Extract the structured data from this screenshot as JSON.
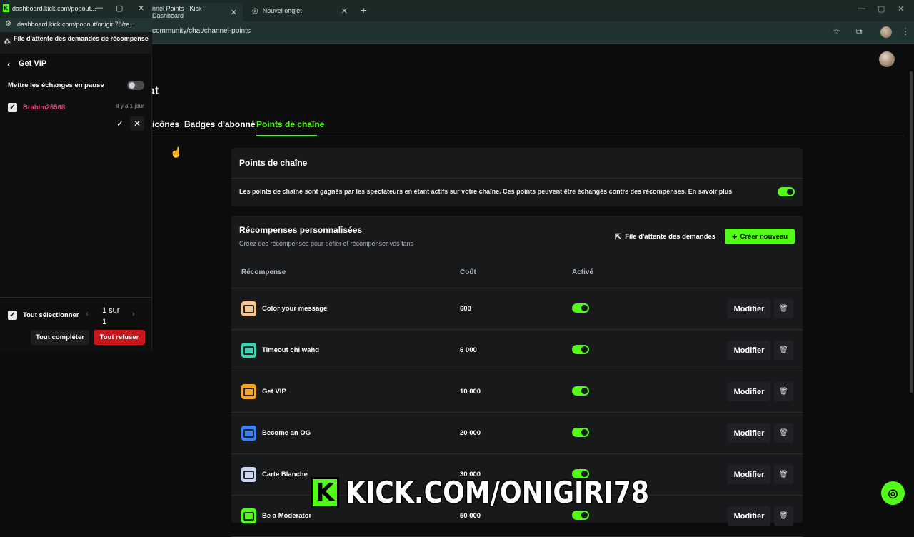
{
  "browser": {
    "tabs": [
      {
        "label": "nnel Points - Kick Dashboard"
      },
      {
        "label": "Nouvel onglet"
      }
    ],
    "url": "community/chat/channel-points"
  },
  "popup": {
    "url_title": "dashboard.kick.com/popout...",
    "url": "dashboard.kick.com/popout/onigiri78/re...",
    "header": "File d'attente des demandes de récompense",
    "back_title": "Get VIP",
    "pause_label": "Mettre les échanges en pause",
    "pause_enabled": false,
    "request": {
      "user": "Brahim26568",
      "time": "il y a 1 jour",
      "selected": true
    },
    "select_all_label": "Tout sélectionner",
    "pagination": "1 sur 1",
    "complete_all": "Tout compléter",
    "refuse_all": "Tout refuser"
  },
  "dashboard": {
    "title_fragment": "at",
    "subtabs": [
      "icônes",
      "Badges d'abonné",
      "Points de chaîne"
    ],
    "active_subtab": "Points de chaîne",
    "points_card": {
      "title": "Points de chaîne",
      "description": "Les points de chaîne sont gagnés par les spectateurs en étant actifs sur votre chaîne. Ces points peuvent être échangés contre des récompenses. En savoir plus",
      "enabled": true
    },
    "rewards_card": {
      "title": "Récompenses personnalisées",
      "subtitle": "Créez des récompenses pour défier et récompenser vos fans",
      "queue_button": "File d'attente des demandes",
      "create_button": "Créer nouveau",
      "columns": [
        "Récompense",
        "Coût",
        "Activé"
      ],
      "modify_label": "Modifier",
      "rows": [
        {
          "name": "Color your message",
          "cost": "600",
          "active": true,
          "color": "#f6c68a"
        },
        {
          "name": "Timeout chi wahd",
          "cost": "6 000",
          "active": true,
          "color": "#3fd3b3"
        },
        {
          "name": "Get VIP",
          "cost": "10 000",
          "active": true,
          "color": "#f5a623"
        },
        {
          "name": "Become an OG",
          "cost": "20 000",
          "active": true,
          "color": "#3b82f6"
        },
        {
          "name": "Carte Blanche",
          "cost": "30 000",
          "active": true,
          "color": "#c8d6ef"
        },
        {
          "name": "Be a Moderator",
          "cost": "50 000",
          "active": true,
          "color": "#53fc18"
        }
      ]
    }
  },
  "overlay": {
    "watermark": "KICK.COM/ONIGIRI78",
    "logo_letter": "K"
  },
  "colors": {
    "accent": "#53fc18",
    "danger": "#c8181e",
    "username": "#e4417f"
  }
}
